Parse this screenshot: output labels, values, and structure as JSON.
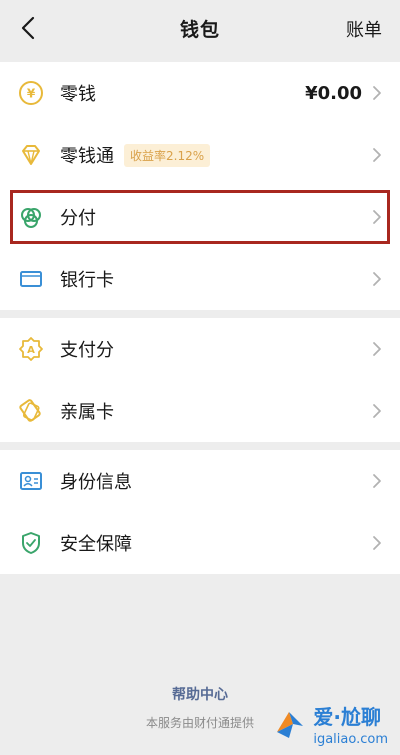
{
  "navbar": {
    "title": "钱包",
    "right_action": "账单"
  },
  "groups": [
    {
      "items": [
        {
          "label": "零钱",
          "value": "¥0.00"
        },
        {
          "label": "零钱通",
          "badge": "收益率2.12%"
        },
        {
          "label": "分付",
          "highlighted": true
        },
        {
          "label": "银行卡"
        }
      ]
    },
    {
      "items": [
        {
          "label": "支付分"
        },
        {
          "label": "亲属卡"
        }
      ]
    },
    {
      "items": [
        {
          "label": "身份信息"
        },
        {
          "label": "安全保障"
        }
      ]
    }
  ],
  "footer": {
    "help_link": "帮助中心",
    "provider_note": "本服务由财付通提供"
  },
  "watermark": {
    "cn_text": "爱·尬聊",
    "url": "igaliao.com"
  },
  "colors": {
    "accent_icon": "#e8b93a",
    "green_icon": "#3aa56b",
    "blue_icon": "#3a8fd6",
    "highlight_border": "#a8271f",
    "link": "#576b95"
  }
}
